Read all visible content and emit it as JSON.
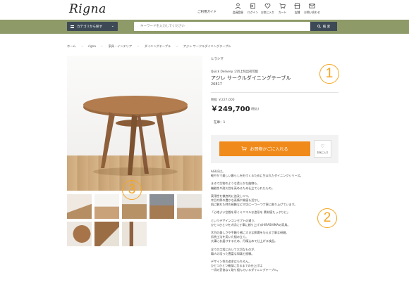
{
  "header": {
    "logo": "Rigna",
    "guide_link": "ご利用ガイド",
    "icons": [
      {
        "name": "member-icon",
        "label": "会員登録"
      },
      {
        "name": "login-icon",
        "label": "ログイン"
      },
      {
        "name": "heart-icon",
        "label": "お気に入り"
      },
      {
        "name": "cart-icon",
        "label": "カート"
      },
      {
        "name": "shop-icon",
        "label": "店舗"
      },
      {
        "name": "contact-icon",
        "label": "お問い合わせ"
      }
    ]
  },
  "search": {
    "category_button": "カテゴリから探す",
    "placeholder": "キーワードを入力してください",
    "button": "検 索"
  },
  "breadcrumb": [
    "ホーム",
    "rigna",
    "家具・インテリア",
    "ダイニングテーブル",
    "アジレ サークルダイニングテーブル"
  ],
  "product": {
    "brand": "ヒラシマ",
    "quick_delivery": "Quick Delivery :2月上旬出荷可能",
    "name": "アジレ サークルダイニングテーブル",
    "code": "26817",
    "old_price": "税抜 ￥227,000",
    "price": "￥249,700",
    "tax": "(税込)",
    "stock": "在庫：1",
    "cart_button": "お買物かごに入れる",
    "favorite_button": "お気に入り"
  },
  "description": [
    "AGILEは。",
    "軽やかで美しい暮らしを形づくるために生まれたダイニングシリーズ。",
    "",
    "まるで生物のような柔らかな曲線も、",
    "機能性や耐久性を高めるため仕立てられたもの。",
    "",
    "実用性を徹底的に追及しつつ、",
    "木目や節の豊かな表情や質感も活かし",
    "肌に触れた時の感触など大切に一つ一つ丁寧に創り上げています。",
    "",
    "「心地よい空間を導くミニマルな造形を 素材感たっぷりに」",
    "",
    "というデザインコンセプトの通り、",
    "ひとつひとつを大切に丁寧に創り上げるHIRASHIMAの家具。",
    "",
    "木目の美しさや手触り感に大きな影響を与える丁寧な研磨。",
    "伝統工法を用いた組み立て。",
    "大事にお届けするため、丹精込めて仕上げる検品。",
    "",
    "全ての工程において大切なものが、",
    "職人の培った豊富な知識と経験。",
    "",
    "デザイン性の追求はもちろん。",
    "ひとつひとつ細部に至るまでの仕上げは",
    "一切の妥協なく取り組んでいるダイニングテーブル。"
  ],
  "annotations": [
    "1",
    "2",
    "3"
  ],
  "colors": {
    "band": "#8e9a68",
    "dark_button": "#3d4a55",
    "cart_orange": "#f08a1a",
    "marker_orange": "#f5a623"
  },
  "thumbnails": 8
}
